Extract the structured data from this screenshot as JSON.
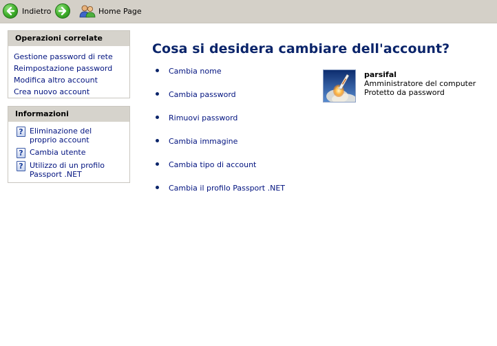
{
  "toolbar": {
    "back_label": "Indietro",
    "home_label": "Home Page"
  },
  "related_tasks": {
    "title": "Operazioni correlate",
    "links": [
      "Gestione password di rete",
      "Reimpostazione password",
      "Modifica altro account",
      "Crea nuovo account"
    ]
  },
  "info": {
    "title": "Informazioni",
    "items": [
      "Eliminazione del proprio account",
      "Cambia utente",
      "Utilizzo di un profilo Passport .NET"
    ]
  },
  "main": {
    "title": "Cosa si desidera cambiare dell'account?",
    "tasks": [
      "Cambia nome",
      "Cambia password",
      "Rimuovi password",
      "Cambia immagine",
      "Cambia tipo di account",
      "Cambia il profilo Passport .NET"
    ]
  },
  "account": {
    "name": "parsifal",
    "type": "Amministratore del computer",
    "status": "Protetto da password"
  },
  "colors": {
    "link": "#00127f",
    "title": "#0a246a",
    "toolbar_bg": "#d4d0c8",
    "panel_header_bg": "#d6d3cc"
  }
}
